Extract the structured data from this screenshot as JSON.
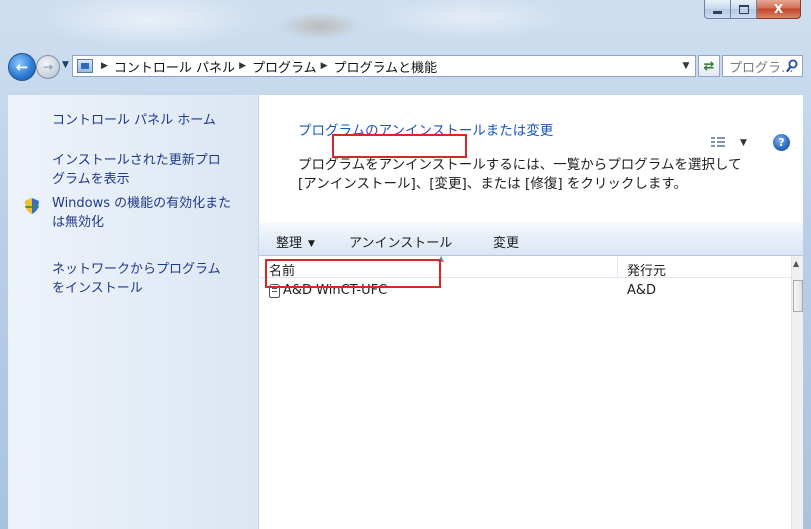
{
  "window": {
    "controls": {
      "minimize_icon": "minimize-icon",
      "maximize_icon": "maximize-icon",
      "close_glyph": "X"
    }
  },
  "nav": {
    "back_icon": "back-arrow-icon",
    "forward_icon": "forward-arrow-icon",
    "breadcrumbs": [
      "コントロール パネル",
      "プログラム",
      "プログラムと機能"
    ],
    "refresh_icon": "refresh-icon",
    "search_placeholder": "プログラ..."
  },
  "sidebar": {
    "items": [
      {
        "label_lines": [
          "コントロール パネル ホーム"
        ]
      },
      {
        "label_lines": [
          "インストールされた更新プロ",
          "グラムを表示"
        ]
      },
      {
        "label_lines": [
          "Windows の機能の有効化また",
          "は無効化"
        ],
        "icon": "shield-icon"
      },
      {
        "label_lines": [
          "ネットワークからプログラム",
          "をインストール"
        ]
      }
    ]
  },
  "main": {
    "title": "プログラムのアンインストールまたは変更",
    "description_lines": [
      "プログラムをアンインストールするには、一覧からプログラムを選択して",
      "[アンインストール]、[変更]、または [修復] をクリックします。"
    ]
  },
  "toolbar": {
    "organize": "整理",
    "uninstall": "アンインストール",
    "change": "変更",
    "highlight_color": "#d62828"
  },
  "list": {
    "columns": [
      "名前",
      "発行元"
    ],
    "rows": [
      {
        "name": "A&D WinCT-UFC",
        "publisher": "A&D"
      }
    ]
  }
}
